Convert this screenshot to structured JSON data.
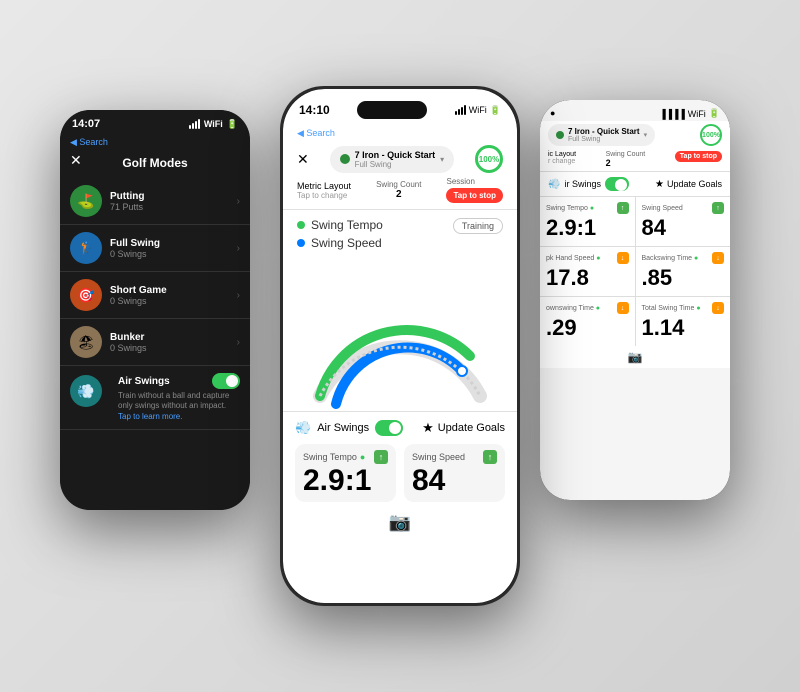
{
  "leftPhone": {
    "time": "14:07",
    "backLabel": "◀ Search",
    "title": "Golf Modes",
    "modes": [
      {
        "name": "Putting",
        "count": "71 Putts",
        "iconType": "green",
        "emoji": "⛳"
      },
      {
        "name": "Full Swing",
        "count": "0 Swings",
        "iconType": "blue",
        "emoji": "🏌️"
      },
      {
        "name": "Short Game",
        "count": "0 Swings",
        "iconType": "orange",
        "emoji": "⛳"
      },
      {
        "name": "Bunker",
        "count": "0 Swings",
        "iconType": "tan",
        "emoji": "🏖️"
      }
    ],
    "airSwings": {
      "name": "Air Swings",
      "description": "Train without a ball and capture only swings without an impact.",
      "tapLabel": "Tap to learn more.",
      "enabled": true
    }
  },
  "centerPhone": {
    "time": "14:10",
    "locationIcon": "▶",
    "closeLabel": "✕",
    "club": {
      "name": "7 Iron - Quick Start",
      "sub": "Full Swing",
      "progress": "100%"
    },
    "metrics": {
      "metricLayout": "Metric Layout",
      "tapToChange": "Tap to change",
      "swingCount": "Swing Count",
      "swingCountValue": "2",
      "session": "Session",
      "tapToStop": "Tap to stop"
    },
    "trainingBadge": "Training",
    "arcLabels": [
      {
        "name": "Swing Tempo",
        "color": "green"
      },
      {
        "name": "Swing Speed",
        "color": "blue"
      }
    ],
    "bottomSection": {
      "airSwingsLabel": "Air Swings",
      "updateGoalsLabel": "Update Goals",
      "card1": {
        "title": "Swing Tempo",
        "arrow": "up",
        "value": "2.9:1",
        "dotColor": "green"
      },
      "card2": {
        "title": "Swing Speed",
        "arrow": "up",
        "value": "84",
        "dotColor": "none"
      }
    },
    "cameraLabel": "📷"
  },
  "rightPhone": {
    "club": {
      "name": "7 Iron - Quick Start",
      "sub": "Full Swing",
      "progress": "100%"
    },
    "metrics": {
      "metricLayout": "ic Layout",
      "tapToChange": "r change",
      "swingCount": "Swing Count",
      "swingCountValue": "2",
      "tapToStop": "Tap to stop"
    },
    "airSwingsLabel": "ir Swings",
    "updateGoalsLabel": "Update Goals",
    "metricCells": [
      {
        "name": "Swing Tempo",
        "arrow": "up",
        "value": "2.9:1",
        "hasDot": true
      },
      {
        "name": "Swing Speed",
        "arrow": "up",
        "value": "84",
        "hasDot": false
      },
      {
        "name": "pk Hand Speed",
        "arrow": "down",
        "value": "17.8",
        "hasDot": true
      },
      {
        "name": "Backswing Time",
        "arrow": "down",
        "value": ".85",
        "hasDot": true
      },
      {
        "name": "ownswing Time",
        "arrow": "down",
        "value": ".29",
        "hasDot": true
      },
      {
        "name": "Total Swing Time",
        "arrow": "down",
        "value": "1.14",
        "hasDot": true
      }
    ]
  }
}
